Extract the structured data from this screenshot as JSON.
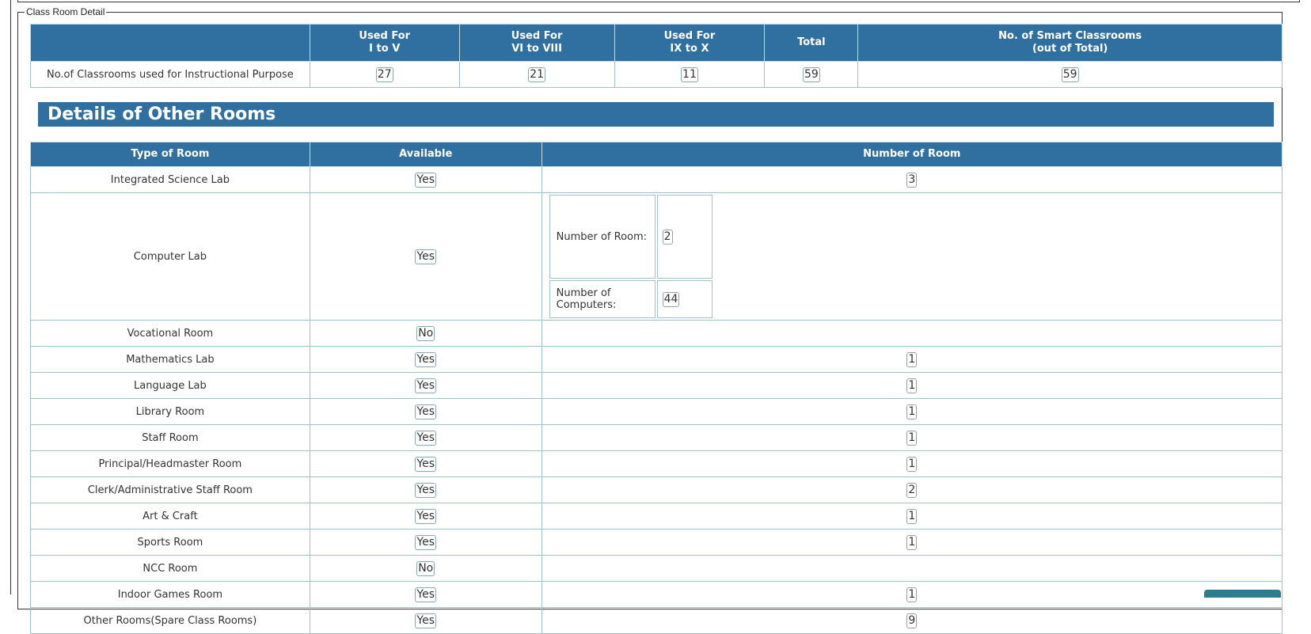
{
  "fieldset_legend": "Class Room Detail",
  "classrooms": {
    "headers": [
      "",
      "Used For\nI to V",
      "Used For\nVI to VIII",
      "Used For\nIX to X",
      "Total",
      "No. of Smart Classrooms\n(out of Total)"
    ],
    "row_label": "No.of Classrooms used for Instructional Purpose",
    "values": [
      "27",
      "21",
      "11",
      "59",
      "59"
    ]
  },
  "other_rooms": {
    "title": "Details of Other Rooms",
    "headers": [
      "Type of Room",
      "Available",
      "Number of Room"
    ],
    "rows": [
      {
        "type": "Integrated Science Lab",
        "available": "Yes",
        "number": "3"
      },
      {
        "type": "Computer Lab",
        "available": "Yes",
        "number_of_room_label": "Number of Room:",
        "number_of_room": "2",
        "number_of_computers_label": "Number of Computers:",
        "number_of_computers": "44"
      },
      {
        "type": "Vocational Room",
        "available": "No",
        "number": ""
      },
      {
        "type": "Mathematics Lab",
        "available": "Yes",
        "number": "1"
      },
      {
        "type": "Language Lab",
        "available": "Yes",
        "number": "1"
      },
      {
        "type": "Library Room",
        "available": "Yes",
        "number": "1"
      },
      {
        "type": "Staff Room",
        "available": "Yes",
        "number": "1"
      },
      {
        "type": "Principal/Headmaster Room",
        "available": "Yes",
        "number": "1"
      },
      {
        "type": "Clerk/Administrative Staff Room",
        "available": "Yes",
        "number": "2"
      },
      {
        "type": "Art & Craft",
        "available": "Yes",
        "number": "1"
      },
      {
        "type": "Sports Room",
        "available": "Yes",
        "number": "1"
      },
      {
        "type": "NCC Room",
        "available": "No",
        "number": ""
      },
      {
        "type": "Indoor Games Room",
        "available": "Yes",
        "number": "1"
      },
      {
        "type": "Other Rooms(Spare Class Rooms)",
        "available": "Yes",
        "number": "9"
      }
    ]
  },
  "colors": {
    "header_bg": "#3070a0",
    "border": "#9fc1cf",
    "button": "#2c7d8f"
  }
}
